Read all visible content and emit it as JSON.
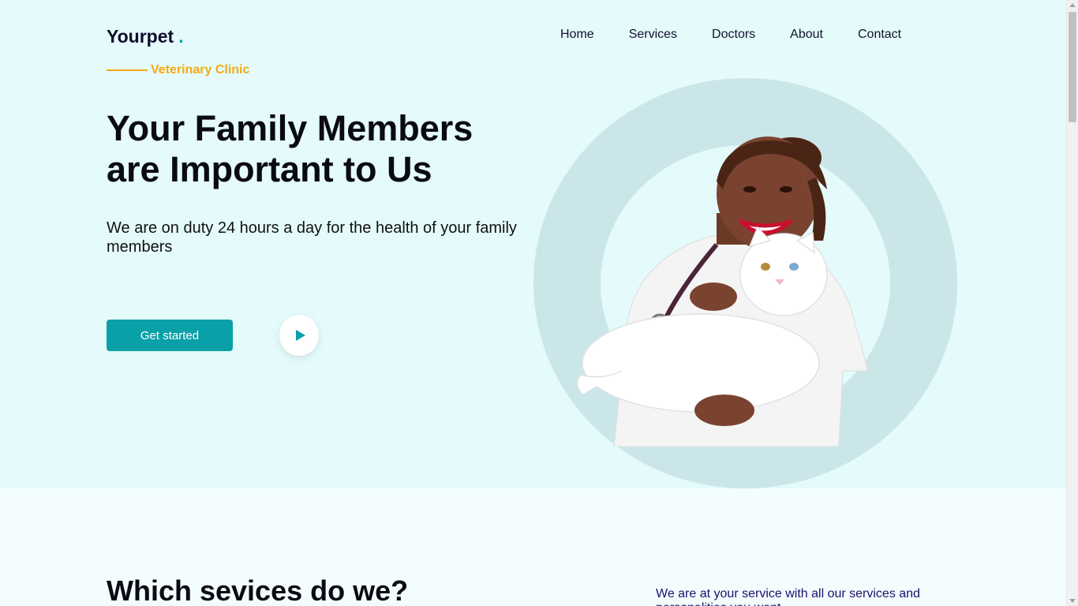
{
  "header": {
    "logo_text": "Yourpet",
    "logo_dot": ".",
    "nav": [
      {
        "label": "Home"
      },
      {
        "label": "Services"
      },
      {
        "label": "Doctors"
      },
      {
        "label": "About"
      },
      {
        "label": "Contact"
      }
    ]
  },
  "hero": {
    "tagline": "Veterinary Clinic",
    "headline_line1": "Your Family Members",
    "headline_line2": "are Important to Us",
    "subtext": "We are on duty 24 hours a day for the health of your family members",
    "cta_label": "Get started",
    "play_icon": "play-icon",
    "image_icon": "veterinarian-holding-white-cat"
  },
  "services": {
    "title": "Which sevices do we?",
    "intro": "We are at your service with all our services and personalities you want"
  },
  "colors": {
    "hero_bg": "#e4fafb",
    "page_bg": "#f3fdfd",
    "accent": "#0aa0a8",
    "tagline": "#f5aa12",
    "ring": "#cbe6e8",
    "services_text": "#1f0f6e"
  }
}
